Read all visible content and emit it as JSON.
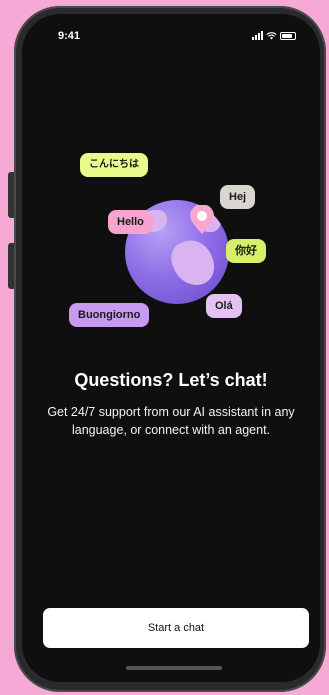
{
  "status_bar": {
    "time": "9:41"
  },
  "bubbles": {
    "konnichiwa": "こんにちは",
    "hej": "Hej",
    "hello": "Hello",
    "nihao": "你好",
    "buongiorno": "Buongiorno",
    "ola": "Olá"
  },
  "content": {
    "headline": "Questions? Let’s chat!",
    "subtext": "Get 24/7 support from our AI assistant in any language, or connect with an agent."
  },
  "actions": {
    "start_chat_label": "Start a chat"
  },
  "colors": {
    "background": "#f6a9d4",
    "screen": "#0f0f10",
    "globe": "#8f6fe8",
    "pin": "#f7a8d0",
    "button": "#ffffff"
  },
  "icons": [
    "signal-icon",
    "wifi-icon",
    "battery-icon",
    "location-pin-icon",
    "globe-icon"
  ]
}
